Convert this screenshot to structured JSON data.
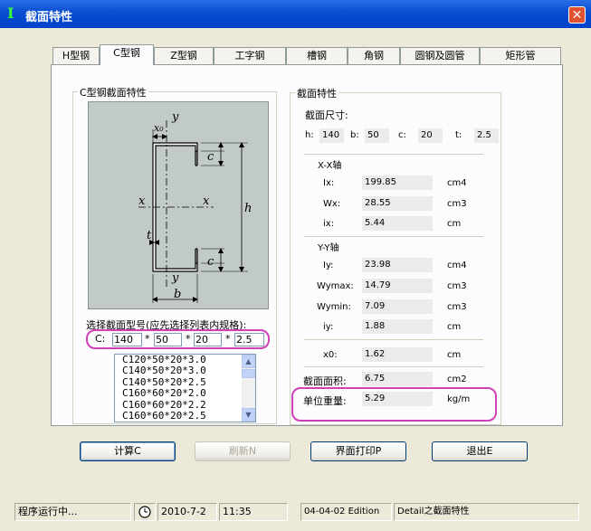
{
  "window": {
    "title": "截面特性",
    "app_icon": "I-beam-icon",
    "close_label": "✕"
  },
  "tabs": [
    {
      "label": "H型钢"
    },
    {
      "label": "C型钢",
      "selected": true
    },
    {
      "label": "Z型钢"
    },
    {
      "label": "工字钢"
    },
    {
      "label": "槽钢"
    },
    {
      "label": "角钢"
    },
    {
      "label": "圆钢及圆管"
    },
    {
      "label": "矩形管"
    }
  ],
  "left_group": {
    "title": "C型钢截面特性",
    "diagram_labels": {
      "y_top": "y",
      "x0": "x₀",
      "c_top": "c",
      "x_left": "x",
      "x_right": "x",
      "h": "h",
      "t": "t",
      "c_bottom": "c",
      "y_bottom": "y",
      "b": "b"
    },
    "select_label": "选择截面型号(应先选择列表内规格):",
    "c_label": "C:",
    "inputs": [
      "140",
      "50",
      "20",
      "2.5"
    ],
    "times": "*",
    "list_items": [
      "C120*50*20*3.0",
      "C140*50*20*3.0",
      "C140*50*20*2.5",
      "C160*60*20*2.0",
      "C160*60*20*2.2",
      "C160*60*20*2.5"
    ]
  },
  "right_group": {
    "title": "截面特性",
    "size_label": "截面尺寸:",
    "dims": [
      {
        "label": "h:",
        "value": "140"
      },
      {
        "label": "b:",
        "value": "50"
      },
      {
        "label": "c:",
        "value": "20"
      },
      {
        "label": "t:",
        "value": "2.5"
      }
    ],
    "xx_header": "X-X轴",
    "xx_props": [
      {
        "label": "Ix:",
        "value": "199.85",
        "unit": "cm4"
      },
      {
        "label": "Wx:",
        "value": "28.55",
        "unit": "cm3"
      },
      {
        "label": "ix:",
        "value": "5.44",
        "unit": "cm"
      }
    ],
    "yy_header": "Y-Y轴",
    "yy_props": [
      {
        "label": "Iy:",
        "value": "23.98",
        "unit": "cm4"
      },
      {
        "label": "Wymax:",
        "value": "14.79",
        "unit": "cm3"
      },
      {
        "label": "Wymin:",
        "value": "7.09",
        "unit": "cm3"
      },
      {
        "label": "iy:",
        "value": "1.88",
        "unit": "cm"
      }
    ],
    "x0": {
      "label": "x0:",
      "value": "1.62",
      "unit": "cm"
    },
    "area": {
      "label": "截面面积:",
      "value": "6.75",
      "unit": "cm2"
    },
    "weight": {
      "label": "单位重量:",
      "value": "5.29",
      "unit": "kg/m"
    }
  },
  "buttons": {
    "calc": "计算C",
    "refresh": "刷新N",
    "print": "界面打印P",
    "exit": "退出E"
  },
  "status": {
    "state": "程序运行中...",
    "clock_icon": "clock-icon",
    "date": "2010-7-2",
    "time": "11:35",
    "edition": "04-04-02 Edition",
    "detail": "Detail之截面特性"
  },
  "colors": {
    "title_bar": "#0a4fd2",
    "highlight": "#d23fb8",
    "window_bg": "#ece9d8"
  }
}
